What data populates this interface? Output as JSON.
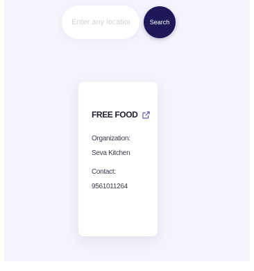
{
  "search": {
    "placeholder": "Enter any location",
    "value": "",
    "button_label": "Search"
  },
  "card": {
    "title": "FREE FOOD",
    "link_icon": "external-link-icon",
    "organization_label": "Organization:",
    "organization_value": "Seva Kitchen",
    "contact_label": "Contact:",
    "contact_value": "9561011264"
  },
  "colors": {
    "page_background": "#f5f4fc",
    "accent": "#1e1858",
    "card_background": "#ffffff"
  }
}
